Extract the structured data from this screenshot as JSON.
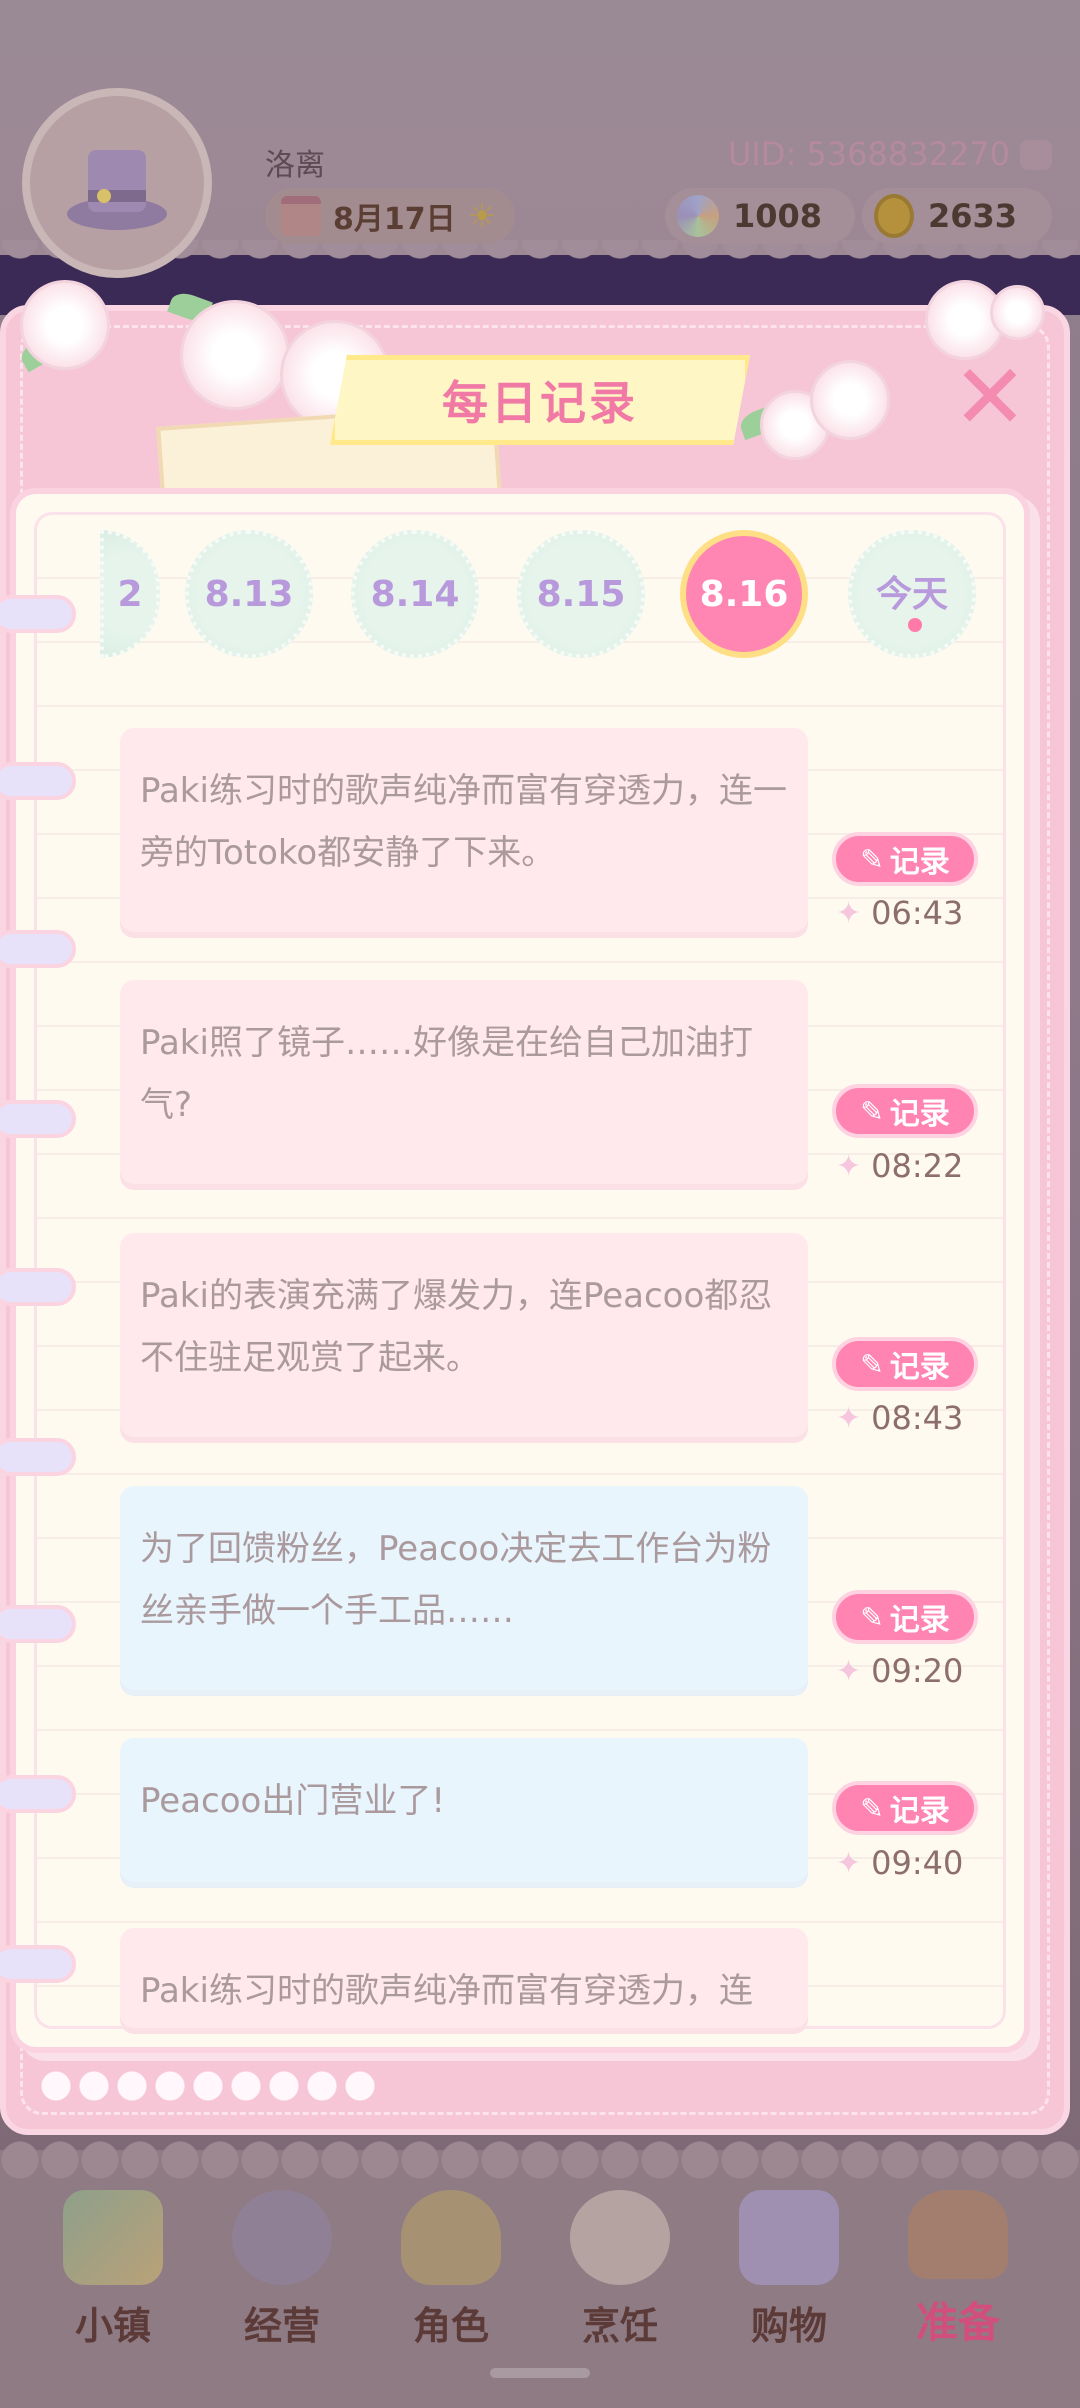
{
  "header": {
    "username": "洛离",
    "uid": "UID: 5368832270",
    "date": "8月17日",
    "gems": "1008",
    "coins": "2633"
  },
  "modal": {
    "title": "每日记录",
    "close_label": "✕"
  },
  "date_tabs": [
    {
      "label": "2",
      "state": "partial"
    },
    {
      "label": "8.13",
      "state": "normal"
    },
    {
      "label": "8.14",
      "state": "normal"
    },
    {
      "label": "8.15",
      "state": "normal"
    },
    {
      "label": "8.16",
      "state": "selected"
    },
    {
      "label": "今天",
      "state": "today"
    }
  ],
  "entries": [
    {
      "text": "Paki练习时的歌声纯净而富有穿透力，连一旁的Totoko都安静了下来。",
      "time": "06:43",
      "tone": "pink",
      "record_label": "记录"
    },
    {
      "text": "Paki照了镜子……好像是在给自己加油打气?",
      "time": "08:22",
      "tone": "pink",
      "record_label": "记录"
    },
    {
      "text": "Paki的表演充满了爆发力，连Peacoo都忍不住驻足观赏了起来。",
      "time": "08:43",
      "tone": "pink",
      "record_label": "记录"
    },
    {
      "text": "为了回馈粉丝，Peacoo决定去工作台为粉丝亲手做一个手工品……",
      "time": "09:20",
      "tone": "blue",
      "record_label": "记录"
    },
    {
      "text": "Peacoo出门营业了!",
      "time": "09:40",
      "tone": "blue",
      "record_label": "记录"
    },
    {
      "text": "Paki练习时的歌声纯净而富有穿透力，连",
      "time": "",
      "tone": "pink",
      "record_label": ""
    }
  ],
  "nav": [
    {
      "label": "小镇",
      "icon": "map-icon"
    },
    {
      "label": "经营",
      "icon": "shop-bag-icon"
    },
    {
      "label": "角色",
      "icon": "character-icon"
    },
    {
      "label": "烹饪",
      "icon": "cooking-icon"
    },
    {
      "label": "购物",
      "icon": "shopping-bag-icon"
    },
    {
      "label": "准备",
      "icon": "basket-icon"
    }
  ],
  "colors": {
    "accent_pink": "#ff84b1",
    "tab_text": "#b799dc",
    "entry_text": "#aa999d"
  }
}
